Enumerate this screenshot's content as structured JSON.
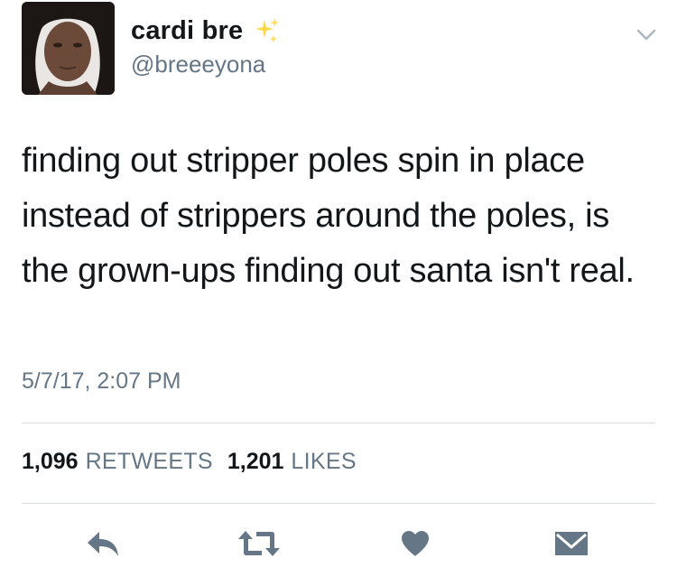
{
  "user": {
    "display_name": "cardi bre",
    "handle": "@breeeyona",
    "avatar_icon": "avatar",
    "name_emoji_icon": "sparkles-icon"
  },
  "tweet": {
    "text": "finding out stripper poles spin in place instead of strippers around the poles, is the grown-ups finding out santa isn't real.",
    "timestamp": "5/7/17, 2:07 PM"
  },
  "stats": {
    "retweets_count": "1,096",
    "retweets_label": "RETWEETS",
    "likes_count": "1,201",
    "likes_label": "LIKES"
  },
  "actions": [
    {
      "name": "reply",
      "icon": "reply-icon"
    },
    {
      "name": "retweet",
      "icon": "retweet-icon"
    },
    {
      "name": "like",
      "icon": "heart-icon"
    },
    {
      "name": "message",
      "icon": "envelope-icon"
    }
  ],
  "colors": {
    "text_primary": "#14171a",
    "text_secondary": "#657786",
    "divider": "#d8dde1",
    "action_icon": "#657786",
    "sparkle": "#ffd84d"
  }
}
